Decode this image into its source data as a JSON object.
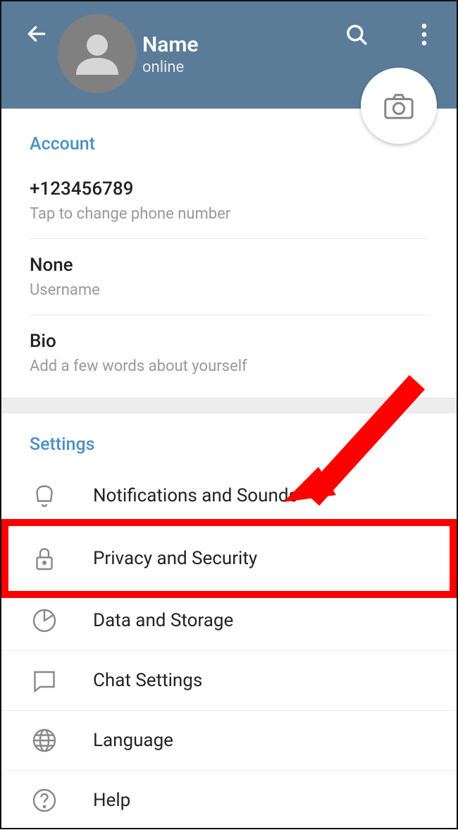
{
  "header": {
    "name": "Name",
    "status": "online"
  },
  "account": {
    "sectionTitle": "Account",
    "phone": {
      "value": "+123456789",
      "sub": "Tap to change phone number"
    },
    "username": {
      "value": "None",
      "sub": "Username"
    },
    "bio": {
      "value": "Bio",
      "sub": "Add a few words about yourself"
    }
  },
  "settings": {
    "sectionTitle": "Settings",
    "items": {
      "notifications": "Notifications and Sounds",
      "privacy": "Privacy and Security",
      "data": "Data and Storage",
      "chat": "Chat Settings",
      "language": "Language",
      "help": "Help"
    }
  }
}
